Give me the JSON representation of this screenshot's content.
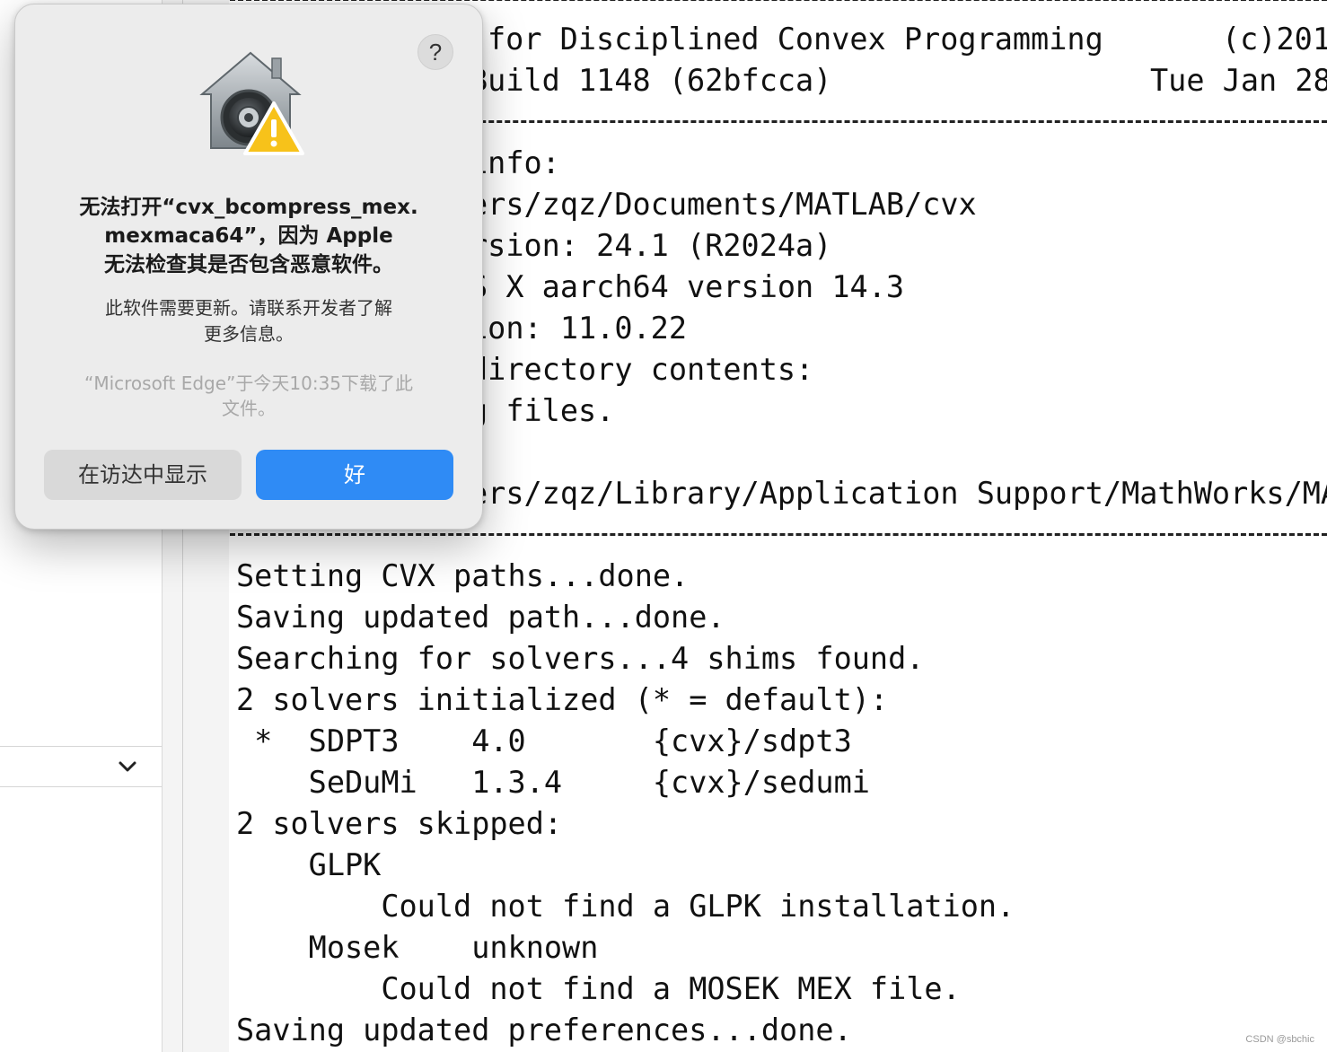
{
  "console": {
    "lines": [
      "--------------------------------------------------------------------",
      "       for Disciplined Convex Programming       (c)201",
      "      Build 1148 (62bfcca)                   Tue Jan 28",
      "--------------------------------------------------------------------",
      "       info:",
      "     ers/zqz/Documents/MATLAB/cvx",
      "      rsion: 24.1 (R2024a)",
      "     S X aarch64 version 14.3",
      "      ion: 11.0.22",
      "      directory contents:",
      "     g files.",
      "",
      "     ers/zqz/Library/Application Support/MathWorks/MA",
      "--------------------------------------------------------------------",
      "Setting CVX paths...done.",
      "Saving updated path...done.",
      "Searching for solvers...4 shims found.",
      "2 solvers initialized (* = default):",
      " *  SDPT3    4.0       {cvx}/sdpt3",
      "    SeDuMi   1.3.4     {cvx}/sedumi",
      "2 solvers skipped:",
      "    GLPK",
      "        Could not find a GLPK installation.",
      "    Mosek    unknown",
      "        Could not find a MOSEK MEX file.",
      "Saving updated preferences...done."
    ]
  },
  "alert": {
    "help_label": "?",
    "title": "无法打开“cvx_bcompress_mex.mexmaca64”，因为 Apple 无法检查其是否包含恶意软件。",
    "title_lines": [
      "无法打开“cvx_bcompress_mex.",
      "mexmaca64”，因为 Apple",
      "无法检查其是否包含恶意软件。"
    ],
    "message_lines": [
      "此软件需要更新。请联系开发者了解",
      "更多信息。"
    ],
    "source_lines": [
      "“Microsoft Edge”于今天10:35下载了此",
      "文件。"
    ],
    "show_in_finder_label": "在访达中显示",
    "ok_label": "好"
  },
  "watermark": "CSDN @sbchic",
  "colors": {
    "ok_button": "#2f8bf5",
    "dialog_bg": "#ececec",
    "warning": "#f7c21a"
  },
  "icons": [
    "gatekeeper-icon",
    "warning-icon",
    "chevron-down-icon"
  ]
}
